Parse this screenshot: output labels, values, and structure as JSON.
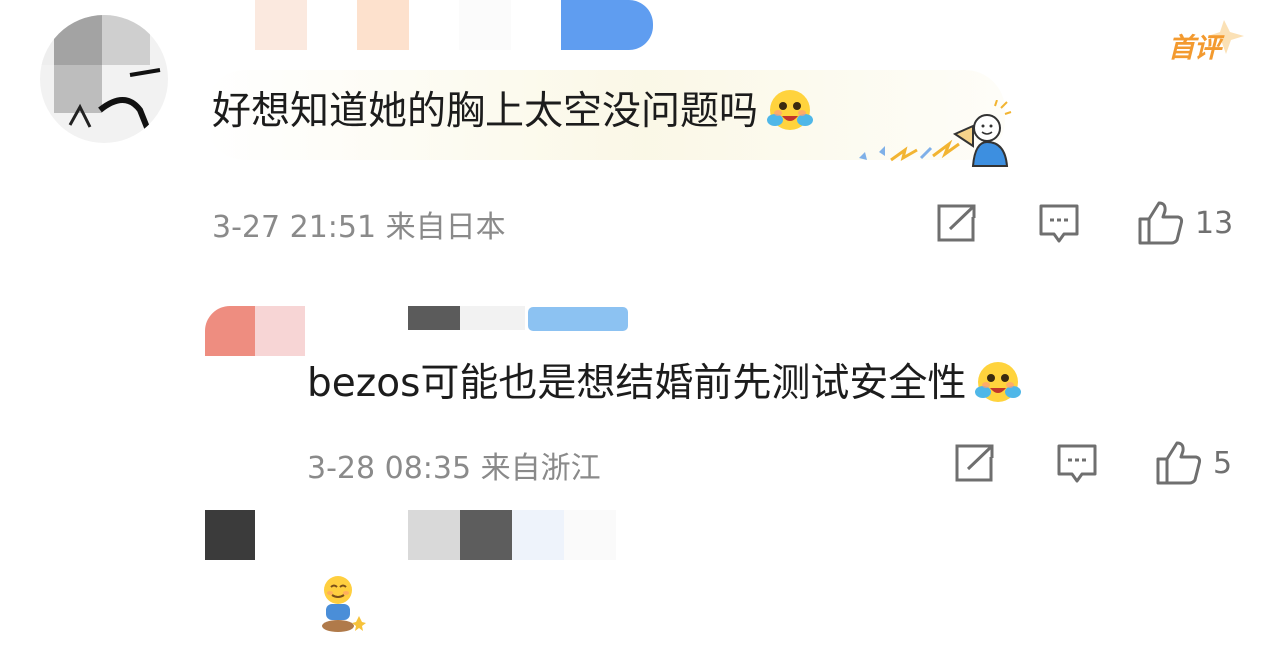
{
  "main_comment": {
    "text": "好想知道她的胸上太空没问题吗",
    "timestamp": "3-27 21:51",
    "location": "来自日本",
    "first_badge": "首评",
    "likes": "13",
    "emoji": "hug-face-emoji",
    "sticker": "megaphone-cheer-sticker"
  },
  "reply_1": {
    "text": "bezos可能也是想结婚前先测试安全性",
    "timestamp": "3-28 08:35",
    "location": "来自浙江",
    "likes": "5",
    "emoji": "hug-face-emoji"
  },
  "reply_2": {
    "sticker": "sitting-smile-sticker"
  },
  "icons": {
    "share": "share-icon",
    "comment": "comment-icon",
    "like": "thumbs-up-icon"
  },
  "colors": {
    "meta_text": "#8a8a8a",
    "badge": "#f39a2f",
    "icon": "#6f6f6f"
  }
}
